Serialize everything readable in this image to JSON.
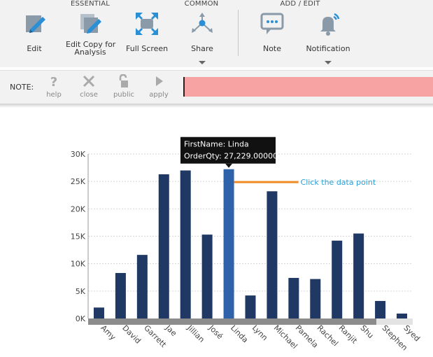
{
  "ribbon": {
    "groups": {
      "essential": "ESSENTIAL",
      "common": "COMMON",
      "add_edit": "ADD / EDIT"
    },
    "buttons": {
      "edit": "Edit",
      "edit_copy_line1": "Edit Copy for",
      "edit_copy_line2": "Analysis",
      "full_screen": "Full Screen",
      "share": "Share",
      "note": "Note",
      "notification": "Notification"
    },
    "icons": {
      "edit": "pencil-icon",
      "edit_copy": "pencil-copy-icon",
      "full_screen": "expand-arrows-icon",
      "share": "share-icon",
      "note": "speech-bubble-icon",
      "notification": "bell-icon"
    },
    "colors": {
      "icon_blue": "#2b8fd6",
      "icon_gray": "#8a9aa8"
    }
  },
  "notebar": {
    "label": "NOTE:",
    "help": "help",
    "close": "close",
    "public": "public",
    "apply": "apply",
    "input_value": "",
    "input_color": "#f8a3a3"
  },
  "chart_data": {
    "type": "bar",
    "categories": [
      "Amy",
      "David",
      "Garrett",
      "Jae",
      "Jillian",
      "José",
      "Linda",
      "Lynn",
      "Michael",
      "Pamela",
      "Rachel",
      "Ranjit",
      "Shu",
      "Stephen",
      "Syed"
    ],
    "values": [
      2000,
      8300,
      11600,
      26300,
      27000,
      15300,
      27229,
      4200,
      23200,
      7400,
      7200,
      14200,
      15500,
      3200,
      900
    ],
    "highlight_index": 6,
    "ylim": [
      0,
      30000
    ],
    "yticks": [
      "0K",
      "5K",
      "10K",
      "15K",
      "20K",
      "25K",
      "30K"
    ],
    "grid": true,
    "bar_color": "#1f3864",
    "highlight_color": "#2e62a9",
    "tooltip": {
      "line1": "FirstName: Linda",
      "line2": "OrderQty: 27,229.00000"
    },
    "annotation": {
      "text": "Click the data point",
      "line_color": "#f08a24",
      "text_color": "#2a9fd6"
    }
  }
}
